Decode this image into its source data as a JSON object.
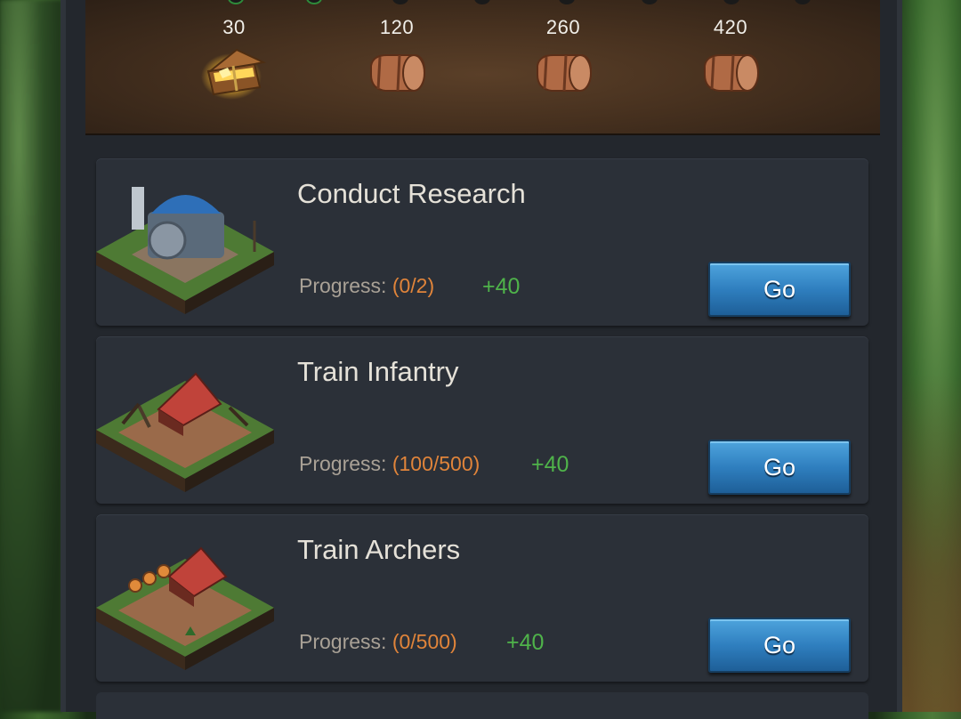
{
  "milestones": [
    {
      "value": "30",
      "reward_icon": "treasure-chest-icon"
    },
    {
      "value": "120",
      "reward_icon": "wooden-chest-icon"
    },
    {
      "value": "260",
      "reward_icon": "wooden-chest-icon"
    },
    {
      "value": "420",
      "reward_icon": "wooden-chest-icon"
    }
  ],
  "tasks": [
    {
      "title": "Conduct Research",
      "progress_label": "Progress:",
      "progress_value": "(0/2)",
      "points": "+40",
      "button": "Go",
      "building_icon": "academy-building-icon"
    },
    {
      "title": "Train Infantry",
      "progress_label": "Progress:",
      "progress_value": "(100/500)",
      "points": "+40",
      "button": "Go",
      "building_icon": "barracks-building-icon"
    },
    {
      "title": "Train Archers",
      "progress_label": "Progress:",
      "progress_value": "(0/500)",
      "points": "+40",
      "button": "Go",
      "building_icon": "archery-range-building-icon"
    }
  ],
  "colors": {
    "accent_button": "#2f7fbf",
    "progress_value": "#e0843a",
    "points": "#4fb34a",
    "panel": "#23272d",
    "card": "#2b3038"
  }
}
